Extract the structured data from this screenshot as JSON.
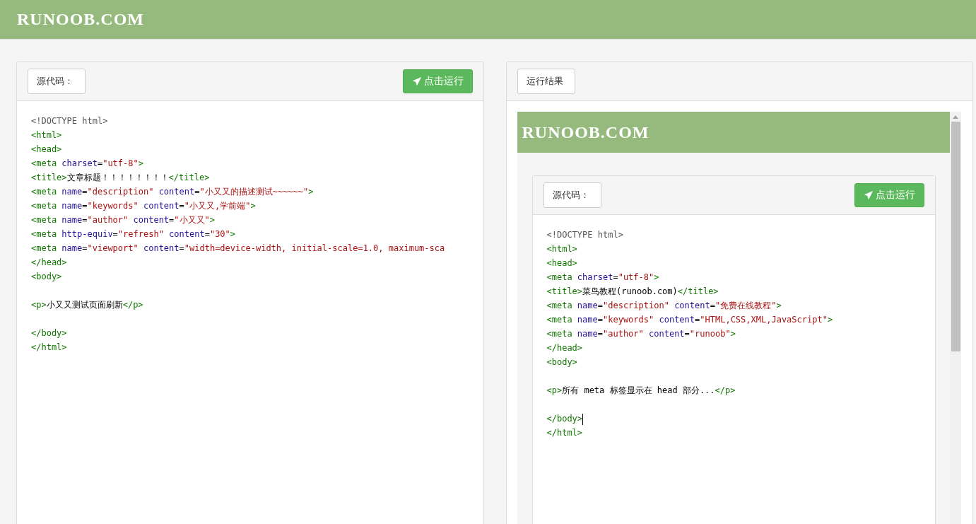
{
  "header": {
    "logo": "RUNOOB.COM"
  },
  "source_panel": {
    "label": "源代码：",
    "run_button": "点击运行",
    "lines": [
      {
        "kind": "code",
        "tokens": [
          {
            "kind": "doctype",
            "text": "<!DOCTYPE html>"
          }
        ]
      },
      {
        "kind": "code",
        "tokens": [
          {
            "kind": "tag",
            "text": "<html>"
          }
        ]
      },
      {
        "kind": "code",
        "tokens": [
          {
            "kind": "tag",
            "text": "<head>"
          }
        ]
      },
      {
        "kind": "code",
        "tokens": [
          {
            "kind": "tag",
            "text": "<meta "
          },
          {
            "kind": "attr",
            "text": "charset"
          },
          {
            "kind": "text",
            "text": "="
          },
          {
            "kind": "value",
            "text": "\"utf-8\""
          },
          {
            "kind": "tag",
            "text": ">"
          }
        ]
      },
      {
        "kind": "code",
        "tokens": [
          {
            "kind": "tag",
            "text": "<title>"
          },
          {
            "kind": "text",
            "text": "文章标题！！！！！！！！"
          },
          {
            "kind": "tag",
            "text": "</title>"
          }
        ]
      },
      {
        "kind": "code",
        "tokens": [
          {
            "kind": "tag",
            "text": "<meta "
          },
          {
            "kind": "attr",
            "text": "name"
          },
          {
            "kind": "text",
            "text": "="
          },
          {
            "kind": "value",
            "text": "\"description\""
          },
          {
            "kind": "attr",
            "text": " content"
          },
          {
            "kind": "text",
            "text": "="
          },
          {
            "kind": "value",
            "text": "\"小又又的描述测试~~~~~~\""
          },
          {
            "kind": "tag",
            "text": ">"
          }
        ]
      },
      {
        "kind": "code",
        "tokens": [
          {
            "kind": "tag",
            "text": "<meta "
          },
          {
            "kind": "attr",
            "text": "name"
          },
          {
            "kind": "text",
            "text": "="
          },
          {
            "kind": "value",
            "text": "\"keywords\""
          },
          {
            "kind": "attr",
            "text": " content"
          },
          {
            "kind": "text",
            "text": "="
          },
          {
            "kind": "value",
            "text": "\"小又又,学前端\""
          },
          {
            "kind": "tag",
            "text": ">"
          }
        ]
      },
      {
        "kind": "code",
        "tokens": [
          {
            "kind": "tag",
            "text": "<meta "
          },
          {
            "kind": "attr",
            "text": "name"
          },
          {
            "kind": "text",
            "text": "="
          },
          {
            "kind": "value",
            "text": "\"author\""
          },
          {
            "kind": "attr",
            "text": " content"
          },
          {
            "kind": "text",
            "text": "="
          },
          {
            "kind": "value",
            "text": "\"小又又\""
          },
          {
            "kind": "tag",
            "text": ">"
          }
        ]
      },
      {
        "kind": "code",
        "tokens": [
          {
            "kind": "tag",
            "text": "<meta "
          },
          {
            "kind": "attr",
            "text": "http-equiv"
          },
          {
            "kind": "text",
            "text": "="
          },
          {
            "kind": "value",
            "text": "\"refresh\""
          },
          {
            "kind": "attr",
            "text": " content"
          },
          {
            "kind": "text",
            "text": "="
          },
          {
            "kind": "value",
            "text": "\"30\""
          },
          {
            "kind": "tag",
            "text": ">"
          }
        ]
      },
      {
        "kind": "code",
        "tokens": [
          {
            "kind": "tag",
            "text": "<meta "
          },
          {
            "kind": "attr",
            "text": "name"
          },
          {
            "kind": "text",
            "text": "="
          },
          {
            "kind": "value",
            "text": "\"viewport\""
          },
          {
            "kind": "attr",
            "text": " content"
          },
          {
            "kind": "text",
            "text": "="
          },
          {
            "kind": "value",
            "text": "\"width=device-width, initial-scale=1.0, maximum-sca"
          }
        ]
      },
      {
        "kind": "code",
        "tokens": [
          {
            "kind": "tag",
            "text": "</head>"
          }
        ]
      },
      {
        "kind": "code",
        "tokens": [
          {
            "kind": "tag",
            "text": "<body>"
          }
        ]
      },
      {
        "kind": "blank"
      },
      {
        "kind": "code",
        "tokens": [
          {
            "kind": "tag",
            "text": "<p>"
          },
          {
            "kind": "text",
            "text": "小又又测试页面刷新"
          },
          {
            "kind": "tag",
            "text": "</p>"
          }
        ]
      },
      {
        "kind": "blank"
      },
      {
        "kind": "code",
        "tokens": [
          {
            "kind": "tag",
            "text": "</body>"
          }
        ]
      },
      {
        "kind": "code",
        "tokens": [
          {
            "kind": "tag",
            "text": "</html>"
          }
        ]
      }
    ]
  },
  "result_panel": {
    "label": "运行结果",
    "preview": {
      "logo": "RUNOOB.COM",
      "label": "源代码：",
      "run_button": "点击运行",
      "lines": [
        {
          "kind": "code",
          "cursor": false,
          "tokens": [
            {
              "kind": "doctype",
              "text": "<!DOCTYPE html>"
            }
          ]
        },
        {
          "kind": "code",
          "cursor": false,
          "tokens": [
            {
              "kind": "tag",
              "text": "<html>"
            }
          ]
        },
        {
          "kind": "code",
          "cursor": false,
          "tokens": [
            {
              "kind": "tag",
              "text": "<head>"
            }
          ]
        },
        {
          "kind": "code",
          "cursor": false,
          "tokens": [
            {
              "kind": "tag",
              "text": "<meta "
            },
            {
              "kind": "attr",
              "text": "charset"
            },
            {
              "kind": "text",
              "text": "="
            },
            {
              "kind": "value",
              "text": "\"utf-8\""
            },
            {
              "kind": "tag",
              "text": ">"
            }
          ]
        },
        {
          "kind": "code",
          "cursor": false,
          "tokens": [
            {
              "kind": "tag",
              "text": "<title>"
            },
            {
              "kind": "text",
              "text": "菜鸟教程(runoob.com)"
            },
            {
              "kind": "tag",
              "text": "</title>"
            }
          ]
        },
        {
          "kind": "code",
          "cursor": false,
          "tokens": [
            {
              "kind": "tag",
              "text": "<meta "
            },
            {
              "kind": "attr",
              "text": "name"
            },
            {
              "kind": "text",
              "text": "="
            },
            {
              "kind": "value",
              "text": "\"description\""
            },
            {
              "kind": "attr",
              "text": " content"
            },
            {
              "kind": "text",
              "text": "="
            },
            {
              "kind": "value",
              "text": "\"免费在线教程\""
            },
            {
              "kind": "tag",
              "text": ">"
            }
          ]
        },
        {
          "kind": "code",
          "cursor": false,
          "tokens": [
            {
              "kind": "tag",
              "text": "<meta "
            },
            {
              "kind": "attr",
              "text": "name"
            },
            {
              "kind": "text",
              "text": "="
            },
            {
              "kind": "value",
              "text": "\"keywords\""
            },
            {
              "kind": "attr",
              "text": " content"
            },
            {
              "kind": "text",
              "text": "="
            },
            {
              "kind": "value",
              "text": "\"HTML,CSS,XML,JavaScript\""
            },
            {
              "kind": "tag",
              "text": ">"
            }
          ]
        },
        {
          "kind": "code",
          "cursor": false,
          "tokens": [
            {
              "kind": "tag",
              "text": "<meta "
            },
            {
              "kind": "attr",
              "text": "name"
            },
            {
              "kind": "text",
              "text": "="
            },
            {
              "kind": "value",
              "text": "\"author\""
            },
            {
              "kind": "attr",
              "text": " content"
            },
            {
              "kind": "text",
              "text": "="
            },
            {
              "kind": "value",
              "text": "\"runoob\""
            },
            {
              "kind": "tag",
              "text": ">"
            }
          ]
        },
        {
          "kind": "code",
          "cursor": false,
          "tokens": [
            {
              "kind": "tag",
              "text": "</head>"
            }
          ]
        },
        {
          "kind": "code",
          "cursor": false,
          "tokens": [
            {
              "kind": "tag",
              "text": "<body>"
            }
          ]
        },
        {
          "kind": "blank"
        },
        {
          "kind": "code",
          "cursor": false,
          "tokens": [
            {
              "kind": "tag",
              "text": "<p>"
            },
            {
              "kind": "text",
              "text": "所有 meta 标签显示在 head 部分..."
            },
            {
              "kind": "tag",
              "text": "</p>"
            }
          ]
        },
        {
          "kind": "blank"
        },
        {
          "kind": "code",
          "cursor": true,
          "tokens": [
            {
              "kind": "tag",
              "text": "</body>"
            }
          ]
        },
        {
          "kind": "code",
          "cursor": false,
          "tokens": [
            {
              "kind": "tag",
              "text": "</html>"
            }
          ]
        }
      ]
    }
  }
}
